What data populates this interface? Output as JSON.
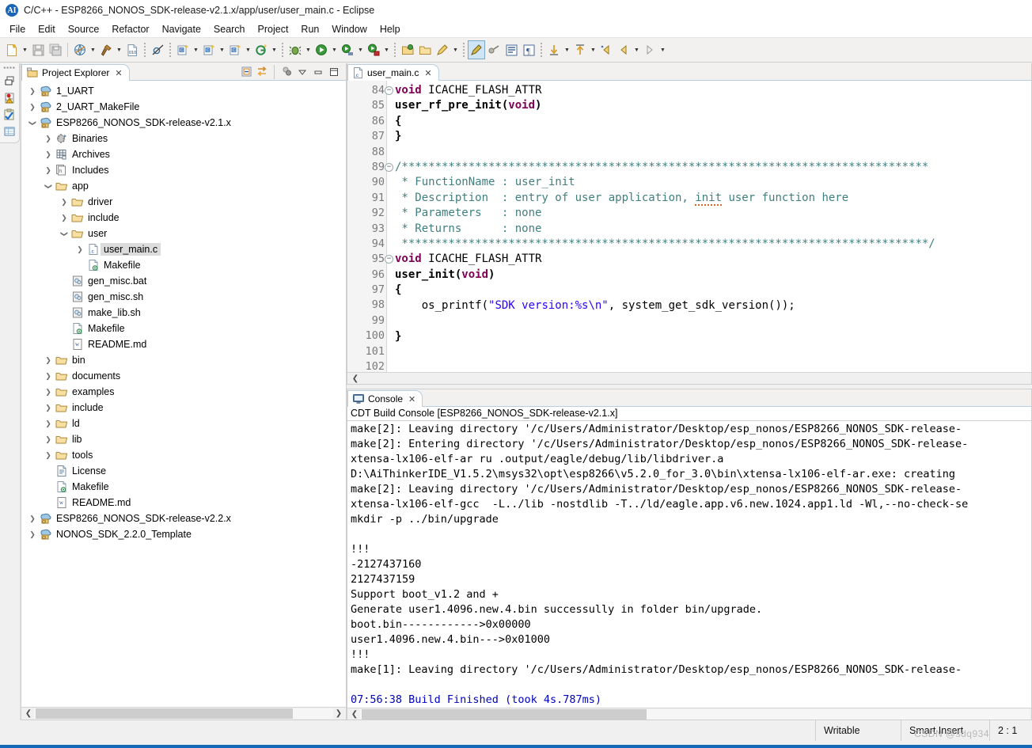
{
  "window": {
    "title": "C/C++ - ESP8266_NONOS_SDK-release-v2.1.x/app/user/user_main.c - Eclipse",
    "logo_text": "AI"
  },
  "menubar": {
    "items": [
      {
        "label": "File"
      },
      {
        "label": "Edit"
      },
      {
        "label": "Source"
      },
      {
        "label": "Refactor"
      },
      {
        "label": "Navigate"
      },
      {
        "label": "Search"
      },
      {
        "label": "Project"
      },
      {
        "label": "Run"
      },
      {
        "label": "Window"
      },
      {
        "label": "Help"
      }
    ]
  },
  "toolbar": {
    "buttons": [
      {
        "name": "new-icon",
        "has_arrow": true
      },
      {
        "name": "save-icon",
        "has_arrow": false
      },
      {
        "name": "save-all-icon",
        "has_arrow": false
      },
      {
        "name": "print-icon",
        "has_arrow": true
      },
      {
        "name": "build-hammer-icon",
        "has_arrow": true
      },
      {
        "name": "binary-010-icon",
        "has_arrow": false
      },
      {
        "name": "skip-breakpoints-icon",
        "has_arrow": false
      },
      {
        "name": "new-c-project-icon",
        "has_arrow": true
      },
      {
        "name": "new-cpp-project-icon",
        "has_arrow": true
      },
      {
        "name": "new-c-file-icon",
        "has_arrow": true
      },
      {
        "name": "new-class-icon",
        "has_arrow": true
      },
      {
        "name": "debug-bug-icon",
        "has_arrow": true
      },
      {
        "name": "run-icon",
        "has_arrow": true
      },
      {
        "name": "run-configurations-icon",
        "has_arrow": true
      },
      {
        "name": "external-tools-icon",
        "has_arrow": true
      },
      {
        "name": "open-type-icon",
        "has_arrow": false
      },
      {
        "name": "open-folder-icon",
        "has_arrow": false
      },
      {
        "name": "marker-pen-icon",
        "has_arrow": true
      },
      {
        "name": "toggle-highlight-icon",
        "has_arrow": false
      },
      {
        "name": "toggle-mark-occurrences-icon",
        "has_arrow": false
      },
      {
        "name": "show-whitespace-icon",
        "has_arrow": false
      },
      {
        "name": "show-pilcrow-icon",
        "has_arrow": false
      },
      {
        "name": "next-annotation-icon",
        "has_arrow": true
      },
      {
        "name": "previous-annotation-icon",
        "has_arrow": true
      },
      {
        "name": "last-edit-location-icon",
        "has_arrow": false
      },
      {
        "name": "back-icon",
        "has_arrow": true
      },
      {
        "name": "forward-icon",
        "has_arrow": true
      }
    ]
  },
  "fastview": {
    "icons": [
      "restore-icon",
      "problems-icon",
      "tasks-icon",
      "properties-icon"
    ]
  },
  "explorer": {
    "tab_label": "Project Explorer",
    "tab_close": "✕",
    "toolbar_icons": [
      "collapse-all-icon",
      "link-with-editor-icon",
      "view-menu-filter-icon",
      "view-menu-icon",
      "minimize-icon",
      "maximize-icon"
    ],
    "tree": [
      {
        "label": "1_UART",
        "depth": 0,
        "arrow": "collapsed",
        "icon": "c-project-icon"
      },
      {
        "label": "2_UART_MakeFile",
        "depth": 0,
        "arrow": "collapsed",
        "icon": "c-project-icon"
      },
      {
        "label": "ESP8266_NONOS_SDK-release-v2.1.x",
        "depth": 0,
        "arrow": "expanded",
        "icon": "c-project-icon"
      },
      {
        "label": "Binaries",
        "depth": 1,
        "arrow": "collapsed",
        "icon": "binaries-icon"
      },
      {
        "label": "Archives",
        "depth": 1,
        "arrow": "collapsed",
        "icon": "archives-icon"
      },
      {
        "label": "Includes",
        "depth": 1,
        "arrow": "collapsed",
        "icon": "includes-icon"
      },
      {
        "label": "app",
        "depth": 1,
        "arrow": "expanded",
        "icon": "folder-icon"
      },
      {
        "label": "driver",
        "depth": 2,
        "arrow": "collapsed",
        "icon": "folder-icon"
      },
      {
        "label": "include",
        "depth": 2,
        "arrow": "collapsed",
        "icon": "folder-icon"
      },
      {
        "label": "user",
        "depth": 2,
        "arrow": "expanded",
        "icon": "folder-icon"
      },
      {
        "label": "user_main.c",
        "depth": 3,
        "arrow": "collapsed",
        "icon": "c-file-icon",
        "selected": true
      },
      {
        "label": "Makefile",
        "depth": 3,
        "arrow": "none",
        "icon": "makefile-icon"
      },
      {
        "label": "gen_misc.bat",
        "depth": 2,
        "arrow": "none",
        "icon": "script-icon"
      },
      {
        "label": "gen_misc.sh",
        "depth": 2,
        "arrow": "none",
        "icon": "script-icon"
      },
      {
        "label": "make_lib.sh",
        "depth": 2,
        "arrow": "none",
        "icon": "script-icon"
      },
      {
        "label": "Makefile",
        "depth": 2,
        "arrow": "none",
        "icon": "makefile-icon"
      },
      {
        "label": "README.md",
        "depth": 2,
        "arrow": "none",
        "icon": "md-file-icon"
      },
      {
        "label": "bin",
        "depth": 1,
        "arrow": "collapsed",
        "icon": "folder-icon"
      },
      {
        "label": "documents",
        "depth": 1,
        "arrow": "collapsed",
        "icon": "folder-icon"
      },
      {
        "label": "examples",
        "depth": 1,
        "arrow": "collapsed",
        "icon": "folder-icon"
      },
      {
        "label": "include",
        "depth": 1,
        "arrow": "collapsed",
        "icon": "folder-icon"
      },
      {
        "label": "ld",
        "depth": 1,
        "arrow": "collapsed",
        "icon": "folder-icon"
      },
      {
        "label": "lib",
        "depth": 1,
        "arrow": "collapsed",
        "icon": "folder-icon"
      },
      {
        "label": "tools",
        "depth": 1,
        "arrow": "collapsed",
        "icon": "folder-icon"
      },
      {
        "label": "License",
        "depth": 1,
        "arrow": "none",
        "icon": "text-file-icon"
      },
      {
        "label": "Makefile",
        "depth": 1,
        "arrow": "none",
        "icon": "makefile-icon"
      },
      {
        "label": "README.md",
        "depth": 1,
        "arrow": "none",
        "icon": "md-file-icon"
      },
      {
        "label": "ESP8266_NONOS_SDK-release-v2.2.x",
        "depth": 0,
        "arrow": "collapsed",
        "icon": "c-project-icon"
      },
      {
        "label": "NONOS_SDK_2.2.0_Template",
        "depth": 0,
        "arrow": "collapsed",
        "icon": "c-project-icon"
      }
    ]
  },
  "editor": {
    "tab_label": "user_main.c",
    "tab_close": "✕",
    "first_line": 84,
    "lines": [
      {
        "n": 84,
        "fold": "−",
        "tokens": [
          {
            "t": "void",
            "c": "kw"
          },
          {
            "t": " ICACHE_FLASH_ATTR",
            "c": ""
          }
        ]
      },
      {
        "n": 85,
        "fold": "",
        "tokens": [
          {
            "t": "user_rf_pre_init",
            "c": "fn"
          },
          {
            "t": "(",
            "c": "fn"
          },
          {
            "t": "void",
            "c": "kw"
          },
          {
            "t": ")",
            "c": "fn"
          }
        ]
      },
      {
        "n": 86,
        "fold": "",
        "tokens": [
          {
            "t": "{",
            "c": "fn"
          }
        ]
      },
      {
        "n": 87,
        "fold": "",
        "tokens": [
          {
            "t": "}",
            "c": "fn"
          }
        ]
      },
      {
        "n": 88,
        "fold": "",
        "tokens": []
      },
      {
        "n": 89,
        "fold": "−",
        "tokens": [
          {
            "t": "/*******************************************************************************",
            "c": "cm"
          }
        ]
      },
      {
        "n": 90,
        "fold": "",
        "tokens": [
          {
            "t": " * FunctionName : user_init",
            "c": "cm"
          }
        ]
      },
      {
        "n": 91,
        "fold": "",
        "tokens": [
          {
            "t": " * Description  : entry of user application, ",
            "c": "cm"
          },
          {
            "t": "init",
            "c": "cm spell"
          },
          {
            "t": " user function here",
            "c": "cm"
          }
        ]
      },
      {
        "n": 92,
        "fold": "",
        "tokens": [
          {
            "t": " * Parameters   : none",
            "c": "cm"
          }
        ]
      },
      {
        "n": 93,
        "fold": "",
        "tokens": [
          {
            "t": " * Returns      : none",
            "c": "cm"
          }
        ]
      },
      {
        "n": 94,
        "fold": "",
        "tokens": [
          {
            "t": " *******************************************************************************/",
            "c": "cm"
          }
        ]
      },
      {
        "n": 95,
        "fold": "−",
        "tokens": [
          {
            "t": "void",
            "c": "kw"
          },
          {
            "t": " ICACHE_FLASH_ATTR",
            "c": ""
          }
        ]
      },
      {
        "n": 96,
        "fold": "",
        "tokens": [
          {
            "t": "user_init",
            "c": "fn"
          },
          {
            "t": "(",
            "c": "fn"
          },
          {
            "t": "void",
            "c": "kw"
          },
          {
            "t": ")",
            "c": "fn"
          }
        ]
      },
      {
        "n": 97,
        "fold": "",
        "tokens": [
          {
            "t": "{",
            "c": "fn"
          }
        ]
      },
      {
        "n": 98,
        "fold": "",
        "tokens": [
          {
            "t": "    os_printf(",
            "c": ""
          },
          {
            "t": "\"SDK version:%s\\n\"",
            "c": "st"
          },
          {
            "t": ", system_get_sdk_version());",
            "c": ""
          }
        ]
      },
      {
        "n": 99,
        "fold": "",
        "tokens": []
      },
      {
        "n": 100,
        "fold": "",
        "tokens": [
          {
            "t": "}",
            "c": "fn"
          }
        ]
      },
      {
        "n": 101,
        "fold": "",
        "tokens": []
      },
      {
        "n": 102,
        "fold": "",
        "tokens": []
      }
    ]
  },
  "console": {
    "tab_label": "Console",
    "tab_close": "✕",
    "subtitle": "CDT Build Console [ESP8266_NONOS_SDK-release-v2.1.x]",
    "lines": [
      {
        "text": "make[2]: Leaving directory '/c/Users/Administrator/Desktop/esp_nonos/ESP8266_NONOS_SDK-release-",
        "color": "black"
      },
      {
        "text": "make[2]: Entering directory '/c/Users/Administrator/Desktop/esp_nonos/ESP8266_NONOS_SDK-release-",
        "color": "black"
      },
      {
        "text": "xtensa-lx106-elf-ar ru .output/eagle/debug/lib/libdriver.a",
        "color": "black"
      },
      {
        "text": "D:\\AiThinkerIDE_V1.5.2\\msys32\\opt\\esp8266\\v5.2.0_for_3.0\\bin\\xtensa-lx106-elf-ar.exe: creating ",
        "color": "black"
      },
      {
        "text": "make[2]: Leaving directory '/c/Users/Administrator/Desktop/esp_nonos/ESP8266_NONOS_SDK-release-",
        "color": "black"
      },
      {
        "text": "xtensa-lx106-elf-gcc  -L../lib -nostdlib -T../ld/eagle.app.v6.new.1024.app1.ld -Wl,--no-check-se",
        "color": "black"
      },
      {
        "text": "mkdir -p ../bin/upgrade",
        "color": "black"
      },
      {
        "text": "",
        "color": "black"
      },
      {
        "text": "!!!",
        "color": "black"
      },
      {
        "text": "-2127437160",
        "color": "black"
      },
      {
        "text": "2127437159",
        "color": "black"
      },
      {
        "text": "Support boot_v1.2 and +",
        "color": "black"
      },
      {
        "text": "Generate user1.4096.new.4.bin successully in folder bin/upgrade.",
        "color": "black"
      },
      {
        "text": "boot.bin------------>0x00000",
        "color": "black"
      },
      {
        "text": "user1.4096.new.4.bin--->0x01000",
        "color": "black"
      },
      {
        "text": "!!!",
        "color": "black"
      },
      {
        "text": "make[1]: Leaving directory '/c/Users/Administrator/Desktop/esp_nonos/ESP8266_NONOS_SDK-release-",
        "color": "black"
      },
      {
        "text": "",
        "color": "black"
      },
      {
        "text": "07:56:38 Build Finished (took 4s.787ms)",
        "color": "blue"
      }
    ]
  },
  "statusbar": {
    "writable": "Writable",
    "insert_mode": "Smart Insert",
    "cursor_position": "2 : 1",
    "watermark": "CSDN @sdq934"
  },
  "colors": {
    "accent": "#1668b8",
    "keyword": "#7f0055",
    "comment": "#3f7f7f",
    "string": "#2a00ff",
    "console_highlight": "#0000c0",
    "selection": "#dcdcdc"
  }
}
